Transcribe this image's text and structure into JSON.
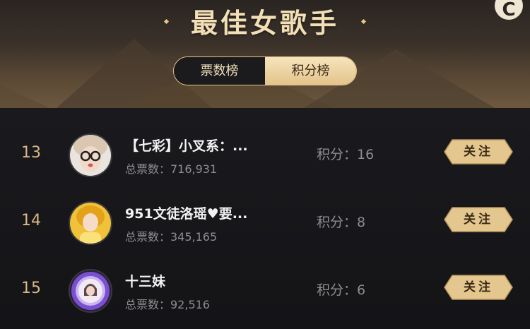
{
  "page": {
    "title": "最佳女歌手",
    "corner_icon": "c-logo-icon"
  },
  "tabs": [
    {
      "label": "票数榜",
      "active": true
    },
    {
      "label": "积分榜",
      "active": false
    }
  ],
  "rows": [
    {
      "rank": "13",
      "name": "【七彩】小叉系：...",
      "votes": "总票数：716,931",
      "score": "积分：16",
      "follow": "关注",
      "avatar": "avatar-glasses-girl"
    },
    {
      "rank": "14",
      "name": "951文徒洛瑶♥要...",
      "votes": "总票数：345,165",
      "score": "积分：8",
      "follow": "关注",
      "avatar": "avatar-yellow-girl"
    },
    {
      "rank": "15",
      "name": "十三妹",
      "votes": "总票数：92,516",
      "score": "积分：6",
      "follow": "关注",
      "avatar": "avatar-purple-frame"
    }
  ],
  "colors": {
    "gold": "#e6c48a",
    "rank": "#d8b786",
    "background": "#16161a"
  }
}
